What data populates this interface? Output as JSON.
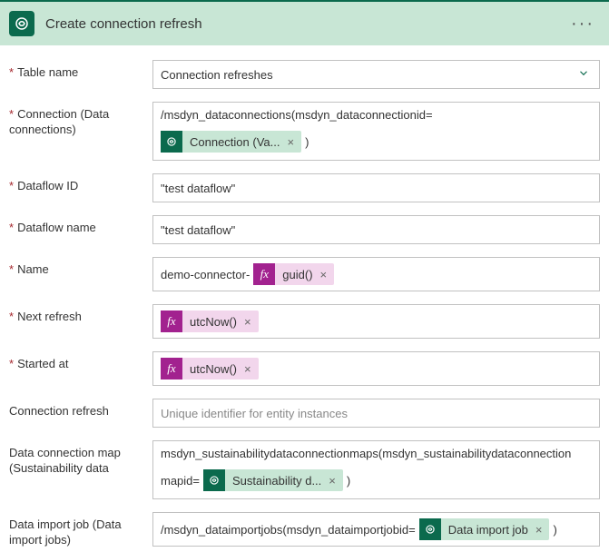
{
  "header": {
    "title": "Create connection refresh",
    "menu": "···"
  },
  "labels": {
    "tableName": "Table name",
    "connection": "Connection (Data connections)",
    "dataflowId": "Dataflow ID",
    "dataflowName": "Dataflow name",
    "name": "Name",
    "nextRefresh": "Next refresh",
    "startedAt": "Started at",
    "connectionRefresh": "Connection refresh",
    "dataConnectionMap": "Data connection map (Sustainability data",
    "dataImportJob": "Data import job (Data import jobs)"
  },
  "values": {
    "tableName": "Connection refreshes",
    "connectionPath": "/msdyn_dataconnections(msdyn_dataconnectionid=",
    "connectionToken": "Connection (Va...",
    "closeParen": ")",
    "dataflowId": "\"test dataflow\"",
    "dataflowName": "\"test dataflow\"",
    "namePrefix": "demo-connector-",
    "guidToken": "guid()",
    "utcNowToken": "utcNow()",
    "connectionRefreshPlaceholder": "Unique identifier for entity instances",
    "dataConnectionMapLine1": "msdyn_sustainabilitydataconnectionmaps(msdyn_sustainabilitydataconnection",
    "dataConnectionMapPrefix": "mapid=",
    "sustainabilityToken": "Sustainability d...",
    "dataImportJobPrefix": "/msdyn_dataimportjobs(msdyn_dataimportjobid=",
    "dataImportJobToken": "Data import job",
    "fxLabel": "fx",
    "closeX": "×"
  }
}
